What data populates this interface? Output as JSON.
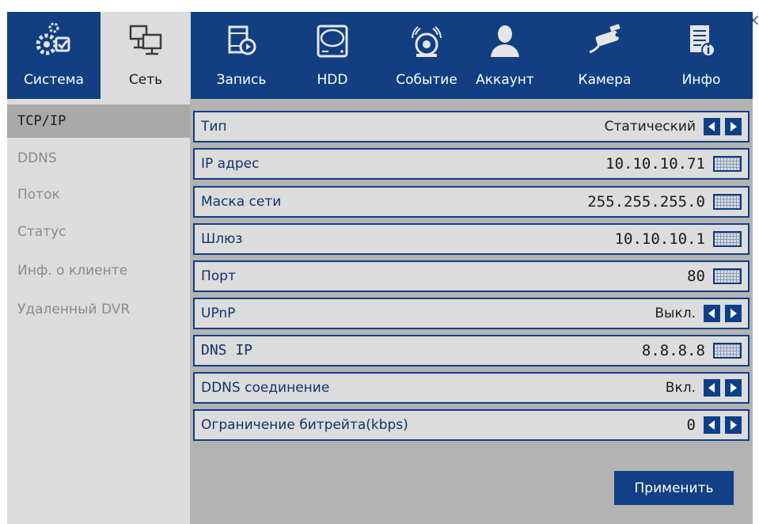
{
  "window": {
    "close_glyph": "×"
  },
  "tabs": [
    {
      "label": "Система",
      "icon": "settings-check-icon",
      "active": false
    },
    {
      "label": "Сеть",
      "icon": "network-icon",
      "active": true
    },
    {
      "label": "Запись",
      "icon": "record-film-icon",
      "active": false
    },
    {
      "label": "HDD",
      "icon": "hdd-icon",
      "active": false
    },
    {
      "label": "Событие",
      "icon": "alarm-event-icon",
      "active": false
    },
    {
      "label": "Аккаунт",
      "icon": "user-account-icon",
      "active": false
    },
    {
      "label": "Камера",
      "icon": "camera-icon",
      "active": false
    },
    {
      "label": "Инфо",
      "icon": "info-icon",
      "active": false
    }
  ],
  "sidebar": {
    "items": [
      {
        "label": "TCP/IP",
        "active": true
      },
      {
        "label": "DDNS",
        "active": false
      },
      {
        "label": "Поток",
        "active": false
      },
      {
        "label": "Статус",
        "active": false
      },
      {
        "label": "Инф. о клиенте",
        "active": false
      },
      {
        "label": "Удаленный DVR",
        "active": false
      }
    ]
  },
  "settings": [
    {
      "label": "Тип",
      "value": "Статический",
      "control": "arrows"
    },
    {
      "label": "IP адрес",
      "value": "10.10.10.71",
      "control": "keyboard"
    },
    {
      "label": "Маска сети",
      "value": "255.255.255.0",
      "control": "keyboard"
    },
    {
      "label": "Шлюз",
      "value": "10.10.10.1",
      "control": "keyboard"
    },
    {
      "label": "Порт",
      "value": "80",
      "control": "keyboard"
    },
    {
      "label": "UPnP",
      "value": "Выкл.",
      "control": "arrows"
    },
    {
      "label": "DNS IP",
      "value": "8.8.8.8",
      "control": "keyboard"
    },
    {
      "label": "DDNS соединение",
      "value": "Вкл.",
      "control": "arrows"
    },
    {
      "label": "Ограничение битрейта(kbps)",
      "value": "0",
      "control": "arrows"
    }
  ],
  "apply_label": "Применить",
  "colors": {
    "header_bg": "#113f82",
    "panel_bg": "#dcdcdc",
    "content_bg": "#b3b3b3",
    "accent": "#0c3f88"
  }
}
